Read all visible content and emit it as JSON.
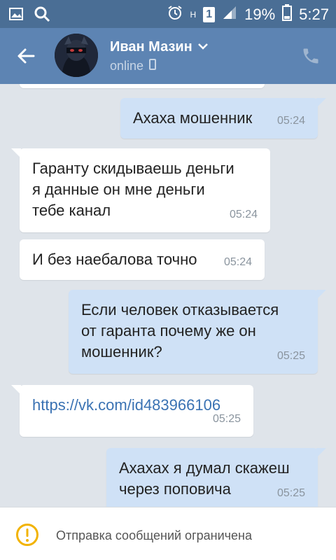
{
  "statusbar": {
    "battery_percent": "19%",
    "time": "5:27",
    "sim_slot": "1",
    "network": "H"
  },
  "header": {
    "name": "Иван Мазин",
    "status": "online"
  },
  "messages": [
    {
      "direction": "out",
      "text": "Ахаха мошенник",
      "time": "05:24"
    },
    {
      "direction": "in",
      "lines": [
        "Гаранту скидываешь деньги",
        "я данные он мне деньги",
        "тебе канал"
      ],
      "time": "05:24"
    },
    {
      "direction": "in",
      "text": "И без наебалова точно",
      "time": "05:24"
    },
    {
      "direction": "out",
      "lines": [
        "Если человек отказывается",
        "от гаранта почему же он",
        "мошенник?"
      ],
      "time": "05:25"
    },
    {
      "direction": "in",
      "text": "https://vk.com/id483966106",
      "time": "05:25",
      "is_link": true
    },
    {
      "direction": "out",
      "lines": [
        "Ахахах я думал скажеш",
        "через поповича"
      ],
      "time": "05:25"
    }
  ],
  "notice": {
    "text": "Отправка сообщений ограничена"
  },
  "colors": {
    "header": "#5d84b3",
    "statusbar": "#4a6e95",
    "chat_bg": "#dfe4ea",
    "incoming": "#ffffff",
    "outgoing": "#cfe1f6",
    "link": "#3a72b3",
    "warning": "#f2b300"
  }
}
